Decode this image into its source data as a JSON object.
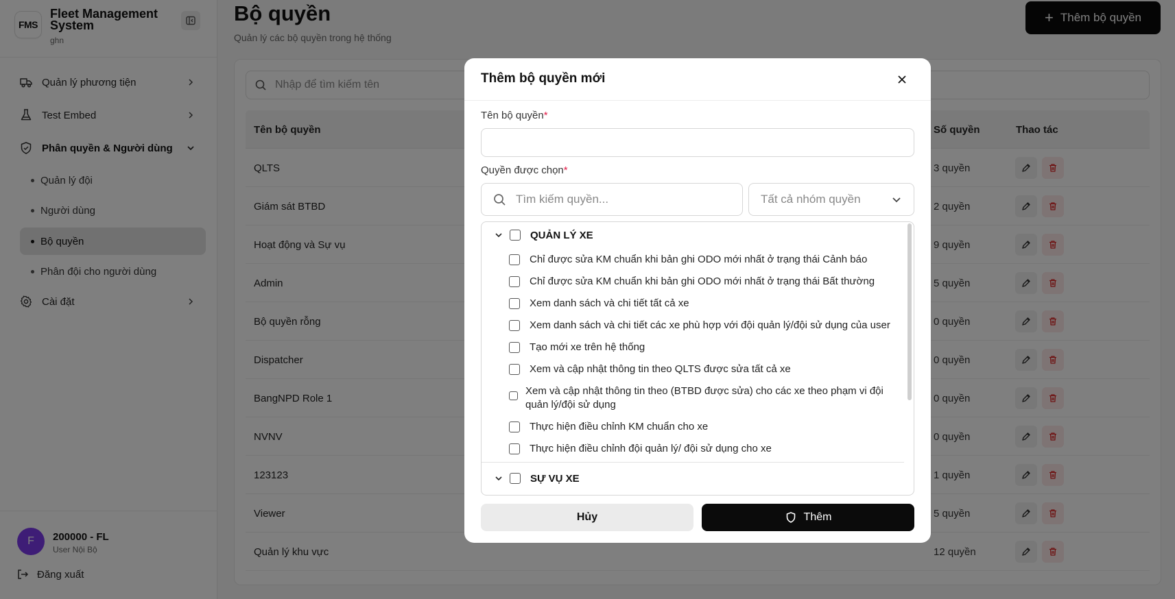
{
  "brand": {
    "logo": "FMS",
    "title": "Fleet Management System",
    "subtitle": "ghn"
  },
  "sidebar": {
    "items": [
      {
        "label": "Quản lý phương tiện",
        "icon": "truck-icon"
      },
      {
        "label": "Test Embed",
        "icon": "flask-icon"
      },
      {
        "label": "Phân quyền & Người dùng",
        "icon": "shield-icon"
      },
      {
        "label": "Cài đặt",
        "icon": "gear-icon"
      }
    ],
    "sub_items": [
      {
        "label": "Quản lý đội"
      },
      {
        "label": "Người dùng"
      },
      {
        "label": "Bộ quyền",
        "active": true
      },
      {
        "label": "Phân đội cho người dùng"
      }
    ]
  },
  "user": {
    "initial": "F",
    "name": "200000 - FL",
    "role": "User Nội Bộ",
    "logout": "Đăng xuất"
  },
  "page": {
    "title": "Bộ quyền",
    "subtitle": "Quản lý các bộ quyền trong hệ thống",
    "add_button": "Thêm bộ quyền"
  },
  "search": {
    "placeholder": "Nhập để tìm kiếm tên"
  },
  "table": {
    "headers": {
      "name": "Tên bộ quyền",
      "count": "Số quyền",
      "actions": "Thao tác"
    },
    "rows": [
      {
        "name": "QLTS",
        "count": "3 quyền"
      },
      {
        "name": "Giám sát BTBD",
        "count": "2 quyền"
      },
      {
        "name": "Hoạt động và Sự vụ",
        "count": "9 quyền"
      },
      {
        "name": "Admin",
        "count": "5 quyền"
      },
      {
        "name": "Bộ quyền rỗng",
        "count": "0 quyền"
      },
      {
        "name": "Dispatcher",
        "count": "0 quyền"
      },
      {
        "name": "BangNPD Role 1",
        "count": "0 quyền"
      },
      {
        "name": "NVNV",
        "count": "0 quyền"
      },
      {
        "name": "123123",
        "count": "1 quyền"
      },
      {
        "name": "Viewer",
        "count": "5 quyền"
      },
      {
        "name": "Quản lý khu vực",
        "count": "12 quyền"
      }
    ]
  },
  "modal": {
    "title": "Thêm bộ quyền mới",
    "name_label": "Tên bộ quyền",
    "name_value": "",
    "perm_label": "Quyền được chọn",
    "required_mark": "*",
    "perm_search_placeholder": "Tìm kiếm quyền...",
    "group_select_value": "Tất cả nhóm quyền",
    "groups": [
      {
        "name": "QUẢN LÝ XE",
        "permissions": [
          "Chỉ được sửa KM chuẩn khi bản ghi ODO mới nhất ở trạng thái Cảnh báo",
          "Chỉ được sửa KM chuẩn khi bản ghi ODO mới nhất ở trạng thái Bất thường",
          "Xem danh sách và chi tiết tất cả xe",
          "Xem danh sách và chi tiết các xe phù hợp với đội quản lý/đội sử dụng của user",
          "Tạo mới xe trên hệ thống",
          "Xem và cập nhật thông tin theo QLTS được sửa tất cả xe",
          "Xem và cập nhật thông tin theo (BTBD được sửa) cho các xe theo phạm vi đội quản lý/đội sử dụng",
          "Thực hiện điều chỉnh KM chuẩn cho xe",
          "Thực hiện điều chỉnh đội quản lý/ đội sử dụng cho xe"
        ]
      },
      {
        "name": "SỰ VỤ XE",
        "permissions": []
      }
    ],
    "cancel": "Hủy",
    "submit": "Thêm"
  }
}
